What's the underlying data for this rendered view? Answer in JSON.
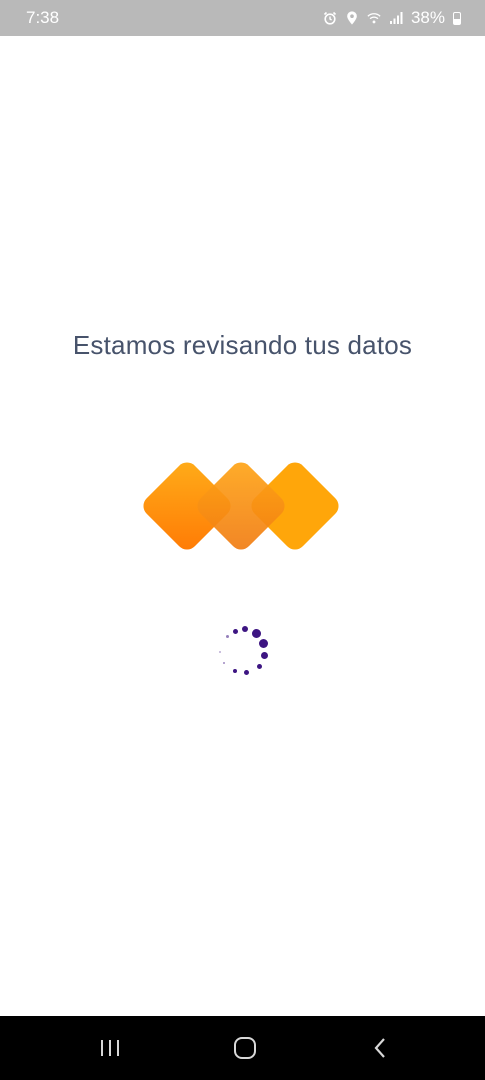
{
  "status_bar": {
    "time": "7:38",
    "battery_percent": "38%",
    "icons": [
      "alarm-icon",
      "location-icon",
      "wifi-icon",
      "signal-icon",
      "battery-icon"
    ]
  },
  "main": {
    "message": "Estamos revisando tus datos"
  },
  "colors": {
    "text": "#47536b",
    "spinner": "#3d1582",
    "logo_light": "#ffae1a",
    "logo_dark": "#ff7a05",
    "status_bar_bg": "#b9b9b9",
    "nav_bar_bg": "#000000"
  },
  "nav_bar": {
    "buttons": [
      "recent-apps-icon",
      "home-icon",
      "back-icon"
    ]
  }
}
